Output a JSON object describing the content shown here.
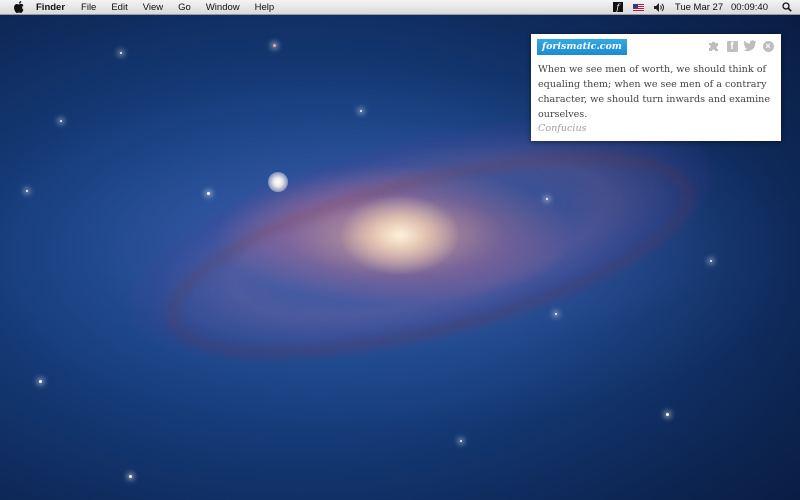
{
  "menubar": {
    "apple_icon": "apple-icon",
    "app_name": "Finder",
    "items": [
      "File",
      "Edit",
      "View",
      "Go",
      "Window",
      "Help"
    ],
    "tray": {
      "forismatic_icon_glyph": "f",
      "input_source": "us-flag-icon",
      "volume_icon": "volume-icon"
    },
    "clock": "Tue Mar 27   00:09:40",
    "spotlight_icon": "search-icon"
  },
  "quote_widget": {
    "logo": "forismatic.com",
    "logo_color": "#2a9ad8",
    "actions": [
      "puzzle-icon",
      "facebook-icon",
      "twitter-icon",
      "close-icon"
    ],
    "facebook_glyph": "f",
    "close_glyph": "×",
    "quote": "When we see men of worth, we should think of equaling them; when we see men of a contrary character, we should turn inwards and examine ourselves.",
    "author": "Confucius"
  },
  "wallpaper": {
    "description_colors": {
      "space": "#163d7c",
      "core": "#ffe7c8"
    }
  }
}
